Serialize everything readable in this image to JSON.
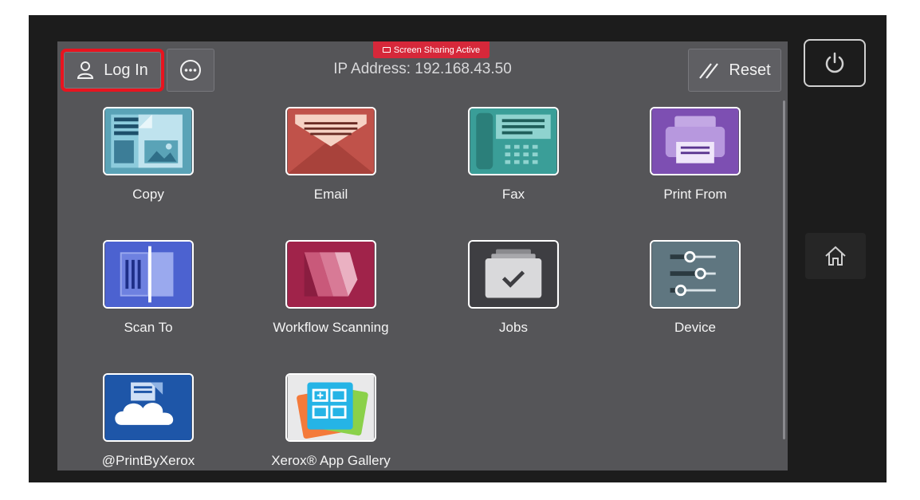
{
  "banner": {
    "text": "Screen Sharing Active"
  },
  "header": {
    "login_label": "Log In",
    "reset_label": "Reset",
    "ip_address": "IP Address: 192.168.43.50"
  },
  "apps": [
    {
      "label": "Copy"
    },
    {
      "label": "Email"
    },
    {
      "label": "Fax"
    },
    {
      "label": "Print From"
    },
    {
      "label": "Scan To"
    },
    {
      "label": "Workflow Scanning"
    },
    {
      "label": "Jobs"
    },
    {
      "label": "Device"
    },
    {
      "label": "@PrintByXerox"
    },
    {
      "label": "Xerox® App Gallery"
    }
  ],
  "colors": {
    "copy": "#5aa3b7",
    "email": "#c0524a",
    "fax": "#3a9e98",
    "print_from": "#7d4fb2",
    "scan_to": "#4c62d0",
    "workflow_scanning": "#a0234a",
    "jobs": "#3e3e42",
    "device": "#5f7680",
    "printbyxerox": "#1e56a8",
    "app_gallery": "#e9e9ea",
    "login_highlight": "#e8141f",
    "banner": "#d6283a"
  }
}
